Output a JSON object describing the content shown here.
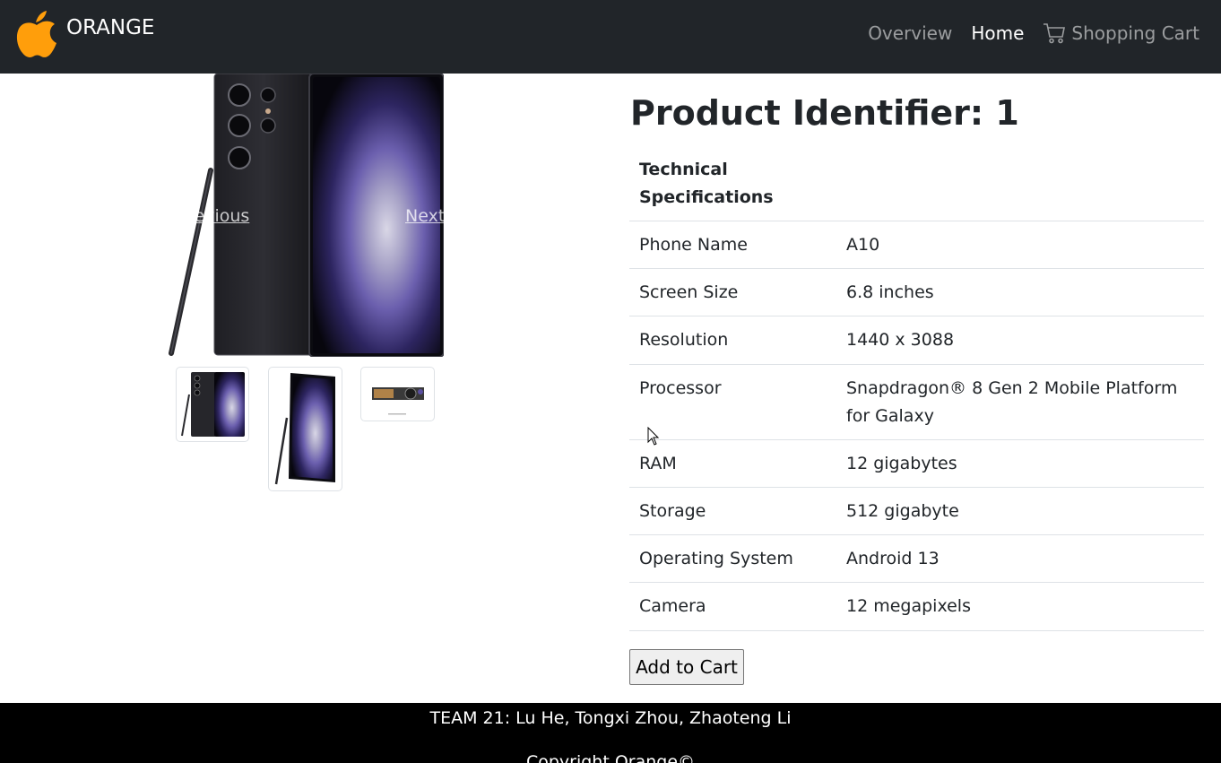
{
  "brand": {
    "name": "ORANGE",
    "logo_icon": "orange-apple-icon",
    "logo_color": "#ff9e0b"
  },
  "nav": {
    "overview_label": "Overview",
    "home_label": "Home",
    "cart_label": "Shopping Cart",
    "cart_icon": "shopping-cart-icon"
  },
  "carousel": {
    "prev_label": "Previous",
    "next_label": "Next",
    "thumbnail_count": 3
  },
  "product": {
    "title": "Product Identifier: 1",
    "specs_header": "Technical Specifications",
    "specs": [
      {
        "label": "Phone Name",
        "value": "A10"
      },
      {
        "label": "Screen Size",
        "value": "6.8 inches"
      },
      {
        "label": "Resolution",
        "value": "1440 x 3088"
      },
      {
        "label": "Processor",
        "value": "Snapdragon® 8 Gen 2 Mobile Platform for Galaxy"
      },
      {
        "label": "RAM",
        "value": "12 gigabytes"
      },
      {
        "label": "Storage",
        "value": "512 gigabyte"
      },
      {
        "label": "Operating System",
        "value": "Android 13"
      },
      {
        "label": "Camera",
        "value": "12 megapixels"
      }
    ],
    "add_to_cart_label": "Add to Cart"
  },
  "footer": {
    "team": "TEAM 21: Lu He, Tongxi Zhou, Zhaoteng Li",
    "copyright": "Copyright Orange©"
  },
  "colors": {
    "navbar_bg": "#212529",
    "footer_bg": "#000000",
    "accent_purple": "#5a4fa0"
  }
}
